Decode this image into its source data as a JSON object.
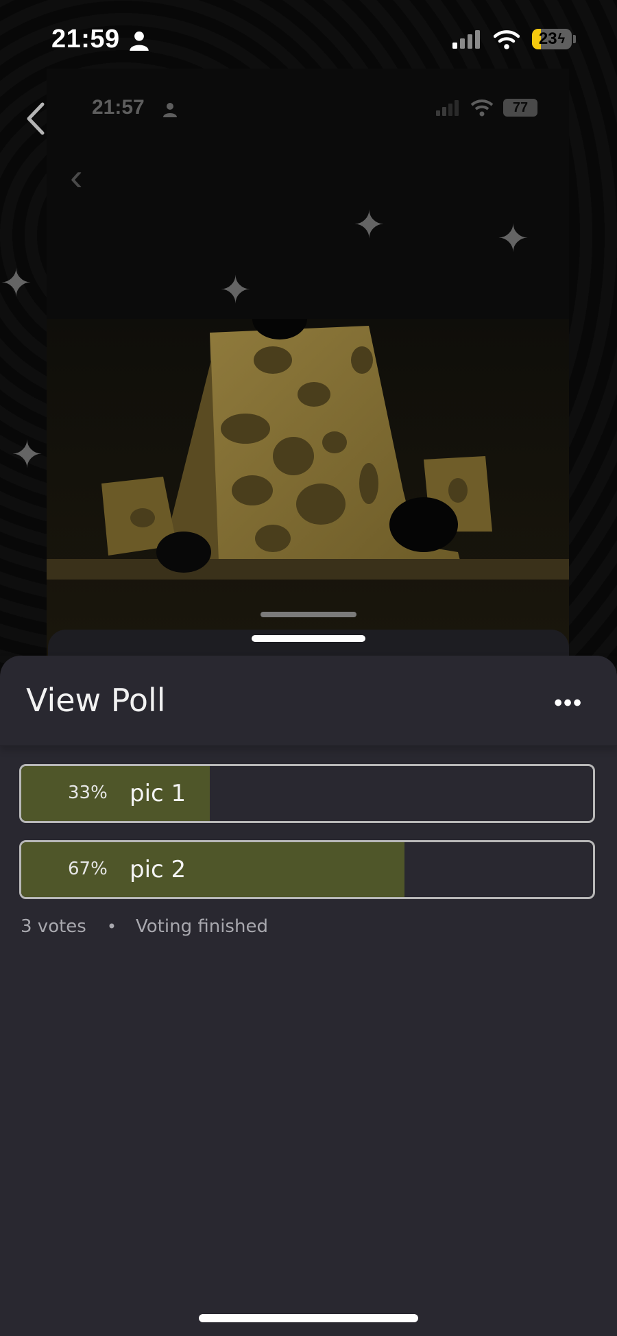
{
  "status_bar": {
    "time": "21:59",
    "battery": "23"
  },
  "inner_screenshot": {
    "time": "21:57",
    "battery": "77"
  },
  "sheet": {
    "title": "View Poll",
    "more_label": "•••"
  },
  "poll": {
    "options": [
      {
        "percent_label": "33%",
        "label": "pic 1",
        "percent": 33
      },
      {
        "percent_label": "67%",
        "label": "pic 2",
        "percent": 67
      }
    ],
    "votes": "3 votes",
    "separator": "•",
    "status": "Voting finished"
  },
  "colors": {
    "bar_fill": "#4f5629",
    "sheet_bg": "#292830",
    "battery_fill": "#f6c90e"
  },
  "icons": {
    "back": "chevron-left-icon",
    "person": "person-icon",
    "signal": "signal-icon",
    "wifi": "wifi-icon",
    "battery": "battery-charging-icon",
    "more": "more-horizontal-icon"
  }
}
